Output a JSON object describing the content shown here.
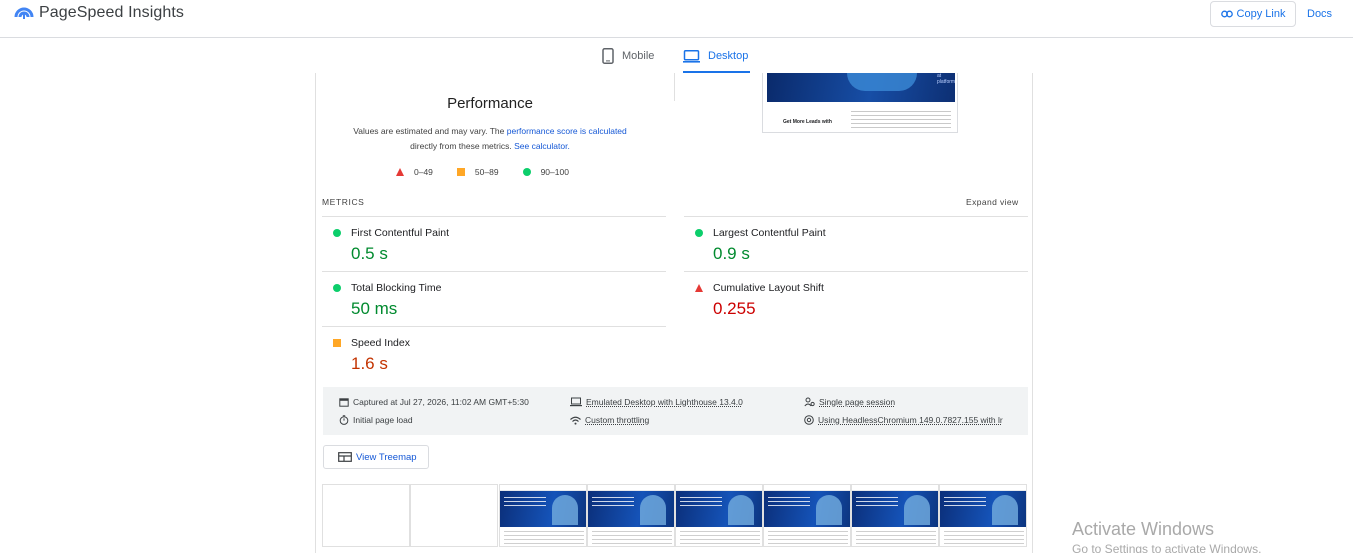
{
  "header": {
    "app_name": "PageSpeed Insights",
    "copy_link_label": "Copy Link",
    "docs_label": "Docs"
  },
  "tabs": [
    {
      "label": "Mobile",
      "icon": "phone-icon",
      "selected": false
    },
    {
      "label": "Desktop",
      "icon": "laptop-icon",
      "selected": true
    }
  ],
  "performance": {
    "title": "Performance",
    "note_prefix": "Values are estimated and may vary. The ",
    "note_link": "performance score is calculated",
    "note_middle": "directly from these metrics. ",
    "note_link2": "See calculator."
  },
  "legend": [
    {
      "range": "0–49",
      "shape": "triangle",
      "color": "#e53935"
    },
    {
      "range": "50–89",
      "shape": "square",
      "color": "#ffa726"
    },
    {
      "range": "90–100",
      "shape": "circle",
      "color": "#0cce6b"
    }
  ],
  "metrics": {
    "section_label": "METRICS",
    "expand_label": "Expand view",
    "items": [
      {
        "name": "First Contentful Paint",
        "value": "0.5 s",
        "rating": "good"
      },
      {
        "name": "Largest Contentful Paint",
        "value": "0.9 s",
        "rating": "good"
      },
      {
        "name": "Total Blocking Time",
        "value": "50 ms",
        "rating": "good"
      },
      {
        "name": "Cumulative Layout Shift",
        "value": "0.255",
        "rating": "poor"
      },
      {
        "name": "Speed Index",
        "value": "1.6 s",
        "rating": "average"
      }
    ]
  },
  "thumbnail": {
    "hero_text": "at platform",
    "subheading": "Get More Leads with"
  },
  "runtime": {
    "captured": "Captured at Jul 27, 2026, 11:02 AM GMT+5:30",
    "page_load": "Initial page load",
    "emulation": "Emulated Desktop with Lighthouse 13.4.0",
    "throttling": "Custom throttling",
    "session": "Single page session",
    "browser": "Using HeadlessChromium 149.0.7827.155 with lr"
  },
  "treemap_label": "View Treemap",
  "filmstrip_frames": 8,
  "watermark": {
    "title": "Activate Windows",
    "subtitle": "Go to Settings to activate Windows."
  },
  "colors": {
    "accent": "#1a73e8",
    "good": "#008a2e",
    "average": "#c33300",
    "poor": "#cc0000"
  }
}
